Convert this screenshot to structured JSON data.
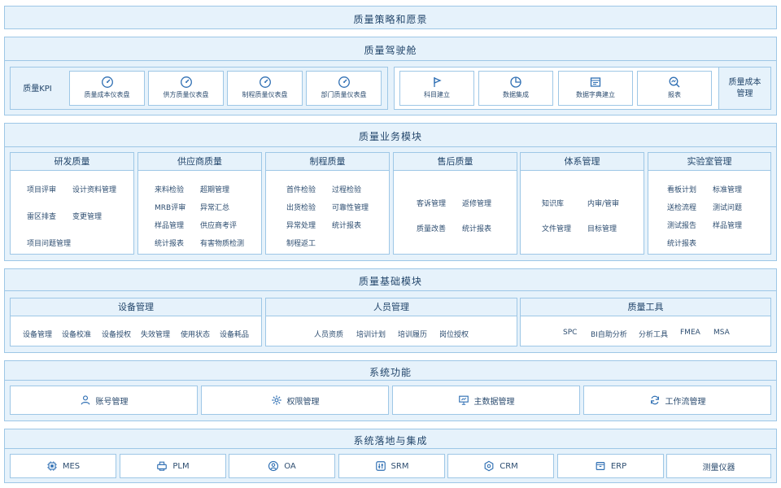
{
  "strategy": {
    "title": "质量策略和愿景"
  },
  "cockpit": {
    "title": "质量驾驶舱",
    "kpi_label": "质量KPI",
    "dashboards": [
      {
        "label": "质量成本仪表盘",
        "icon": "gauge-icon"
      },
      {
        "label": "供方质量仪表盘",
        "icon": "gauge-icon"
      },
      {
        "label": "制程质量仪表盘",
        "icon": "gauge-icon"
      },
      {
        "label": "部门质量仪表盘",
        "icon": "gauge-icon"
      }
    ],
    "tools": [
      {
        "label": "科目建立",
        "icon": "flag-icon"
      },
      {
        "label": "数据集成",
        "icon": "pie-chart-icon"
      },
      {
        "label": "数据字典建立",
        "icon": "calendar-icon"
      },
      {
        "label": "报表",
        "icon": "magnify-chart-icon"
      }
    ],
    "cost_label": "质量成本\n管理"
  },
  "business": {
    "title": "质量业务模块",
    "cards": [
      {
        "title": "研发质量",
        "items": [
          "项目评审",
          "设计资料管理",
          "雷区排查",
          "变更管理",
          "项目问题管理"
        ]
      },
      {
        "title": "供应商质量",
        "items": [
          "来料检验",
          "超期管理",
          "MRB评审",
          "异常汇总",
          "样品管理",
          "供应商考评",
          "统计报表",
          "有害物质检测"
        ]
      },
      {
        "title": "制程质量",
        "items": [
          "首件检验",
          "过程检验",
          "出货检验",
          "可靠性管理",
          "异常处理",
          "统计报表",
          "制程返工"
        ]
      },
      {
        "title": "售后质量",
        "items": [
          "客诉管理",
          "返修管理",
          "质量改善",
          "统计报表"
        ]
      },
      {
        "title": "体系管理",
        "items": [
          "知识库",
          "内审/管审",
          "文件管理",
          "目标管理"
        ]
      },
      {
        "title": "实验室管理",
        "items": [
          "看板计划",
          "标准管理",
          "送检流程",
          "测试问题",
          "测试报告",
          "样品管理",
          "统计报表"
        ]
      }
    ]
  },
  "foundation": {
    "title": "质量基础模块",
    "cards": [
      {
        "title": "设备管理",
        "items": [
          "设备管理",
          "设备校准",
          "设备授权",
          "失效管理",
          "使用状态",
          "设备耗品"
        ]
      },
      {
        "title": "人员管理",
        "items": [
          "人员资质",
          "培训计划",
          "培训履历",
          "岗位授权"
        ]
      },
      {
        "title": "质量工具",
        "items": [
          "SPC",
          "BI自助分析",
          "分析工具",
          "FMEA",
          "MSA"
        ]
      }
    ]
  },
  "system": {
    "title": "系统功能",
    "buttons": [
      {
        "label": "账号管理",
        "icon": "user-icon"
      },
      {
        "label": "权限管理",
        "icon": "gear-icon"
      },
      {
        "label": "主数据管理",
        "icon": "presentation-icon"
      },
      {
        "label": "工作流管理",
        "icon": "refresh-icon"
      }
    ]
  },
  "integration": {
    "title": "系统落地与集成",
    "buttons": [
      {
        "label": "MES",
        "icon": "chip-icon"
      },
      {
        "label": "PLM",
        "icon": "printer-icon"
      },
      {
        "label": "OA",
        "icon": "user-circle-icon"
      },
      {
        "label": "SRM",
        "icon": "sliders-icon"
      },
      {
        "label": "CRM",
        "icon": "hexagon-icon"
      },
      {
        "label": "ERP",
        "icon": "box-icon"
      },
      {
        "label": "测量仪器",
        "icon": ""
      }
    ]
  },
  "colors": {
    "band_bg": "#e6f2fb",
    "border": "#9ec7e6",
    "icon": "#2f6fb3",
    "text": "#23466b"
  }
}
